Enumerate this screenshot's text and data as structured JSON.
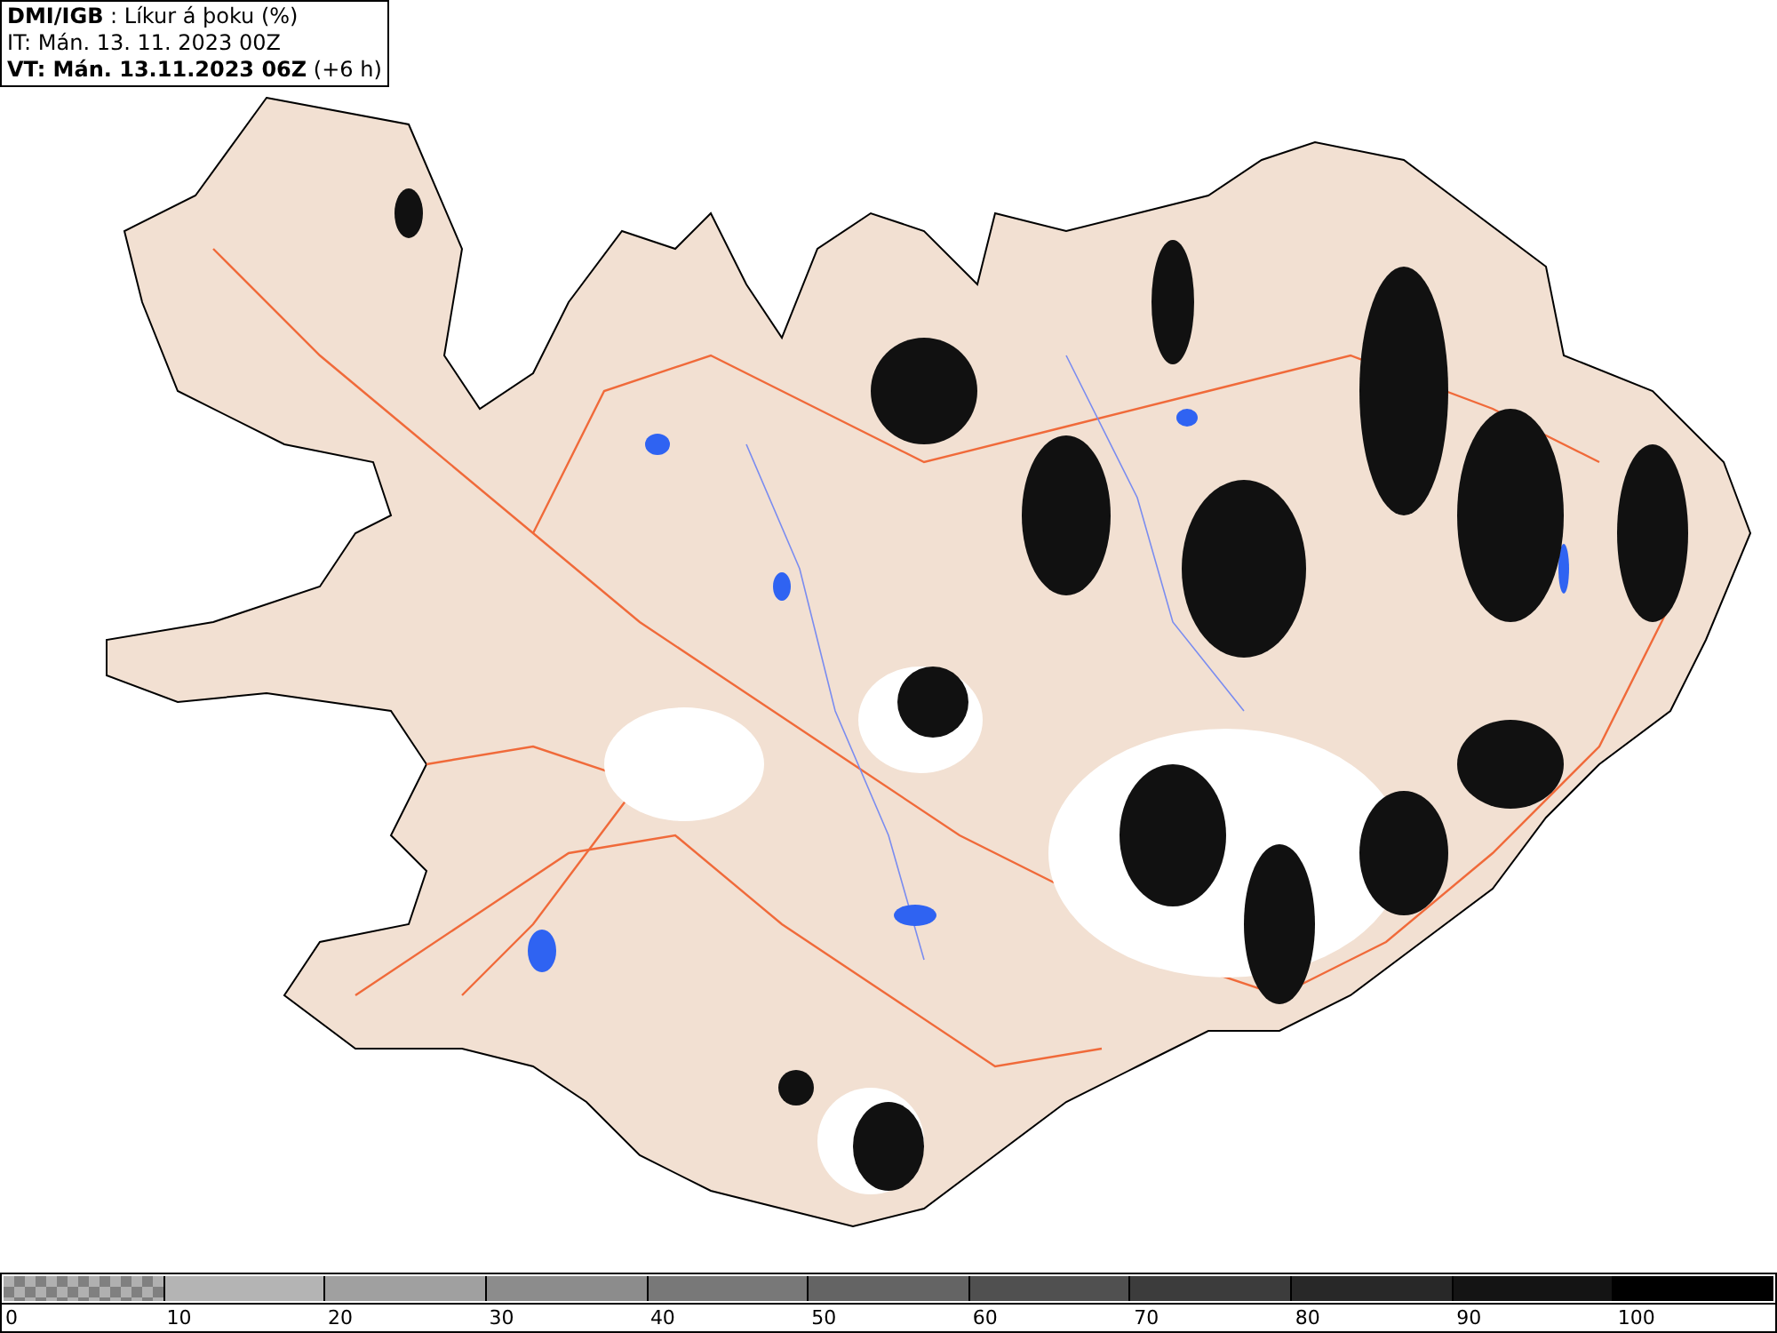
{
  "header": {
    "lines": [
      "**DMI/IGB** : Líkur á þoku (%)",
      "IT: Mán. 13. 11. 2023 00Z",
      "**VT: Mán. 13.11.2023 06Z** (+6 h)"
    ]
  },
  "legend": {
    "swatches": [
      {
        "kind": "checker",
        "color": "#808080"
      },
      {
        "kind": "solid",
        "color": "#b4b4b4"
      },
      {
        "kind": "solid",
        "color": "#a0a0a0"
      },
      {
        "kind": "solid",
        "color": "#8c8c8c"
      },
      {
        "kind": "solid",
        "color": "#787878"
      },
      {
        "kind": "solid",
        "color": "#646464"
      },
      {
        "kind": "solid",
        "color": "#505050"
      },
      {
        "kind": "solid",
        "color": "#3c3c3c"
      },
      {
        "kind": "solid",
        "color": "#282828"
      },
      {
        "kind": "solid",
        "color": "#141414"
      },
      {
        "kind": "solid",
        "color": "#000000"
      }
    ],
    "labels": [
      "0",
      "10",
      "20",
      "30",
      "40",
      "50",
      "60",
      "70",
      "80",
      "90",
      "100"
    ]
  }
}
